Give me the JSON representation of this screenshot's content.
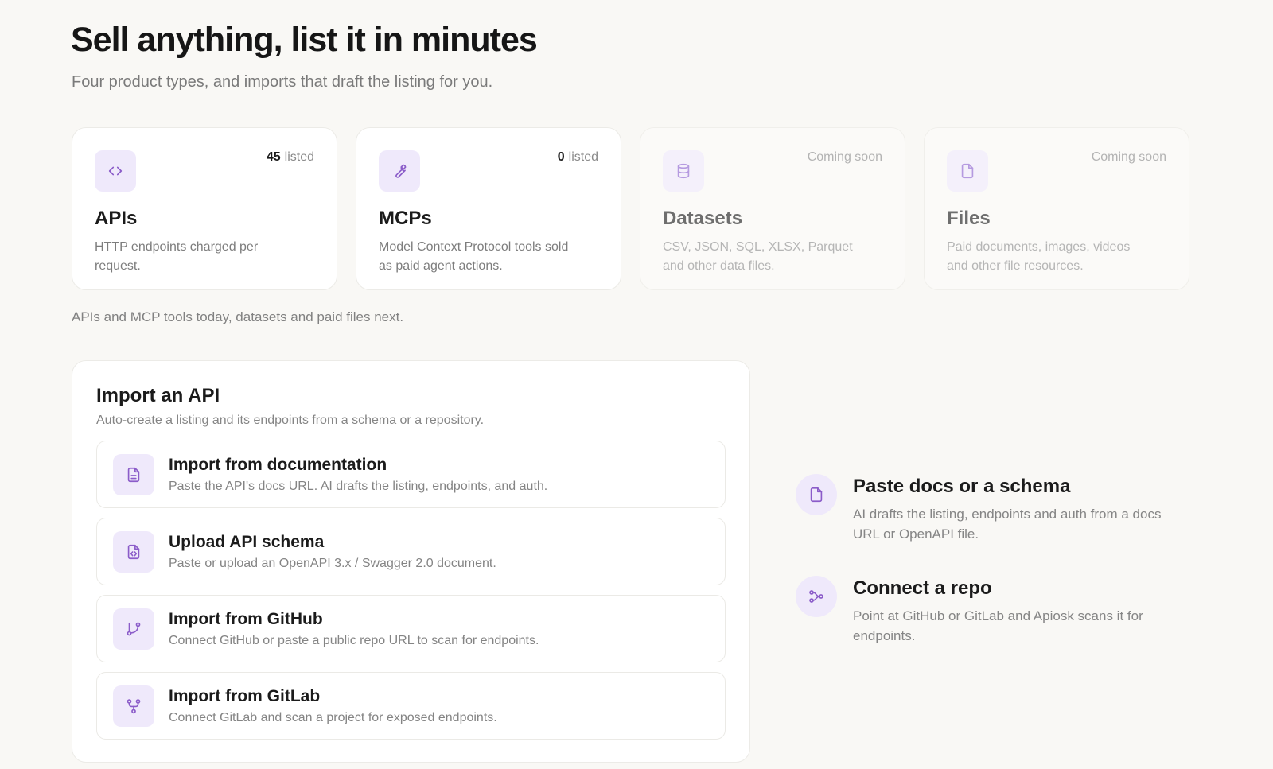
{
  "hero": {
    "title": "Sell anything, list it in minutes",
    "subtitle": "Four product types, and imports that draft the listing for you."
  },
  "product_types": [
    {
      "name": "APIs",
      "count": "45",
      "badge": "listed",
      "description": "HTTP endpoints charged per request.",
      "icon": "code-icon",
      "available": true
    },
    {
      "name": "MCPs",
      "count": "0",
      "badge": "listed",
      "description": "Model Context Protocol tools sold as paid agent actions.",
      "icon": "wrench-icon",
      "available": true
    },
    {
      "name": "Datasets",
      "count": "",
      "badge": "Coming soon",
      "description": "CSV, JSON, SQL, XLSX, Parquet and other data files.",
      "icon": "database-icon",
      "available": false
    },
    {
      "name": "Files",
      "count": "",
      "badge": "Coming soon",
      "description": "Paid documents, images, videos and other file resources.",
      "icon": "file-icon",
      "available": false
    }
  ],
  "types_note": "APIs and MCP tools today, datasets and paid files next.",
  "import": {
    "title": "Import an API",
    "subtitle": "Auto-create a listing and its endpoints from a schema or a repository.",
    "options": [
      {
        "title": "Import from documentation",
        "description": "Paste the API's docs URL. AI drafts the listing, endpoints, and auth.",
        "icon": "document-icon"
      },
      {
        "title": "Upload API schema",
        "description": "Paste or upload an OpenAPI 3.x / Swagger 2.0 document.",
        "icon": "code-file-icon"
      },
      {
        "title": "Import from GitHub",
        "description": "Connect GitHub or paste a public repo URL to scan for endpoints.",
        "icon": "git-branch-icon"
      },
      {
        "title": "Import from GitLab",
        "description": "Connect GitLab and scan a project for exposed endpoints.",
        "icon": "git-fork-icon"
      }
    ]
  },
  "features": [
    {
      "title": "Paste docs or a schema",
      "description": "AI drafts the listing, endpoints and auth from a docs URL or OpenAPI file.",
      "icon": "file-icon"
    },
    {
      "title": "Connect a repo",
      "description": "Point at GitHub or GitLab and Apiosk scans it for endpoints.",
      "icon": "share-nodes-icon"
    }
  ],
  "colors": {
    "accent": "#8b5cc9",
    "accent_bg": "#efe9fb",
    "page_bg": "#f9f8f5"
  }
}
